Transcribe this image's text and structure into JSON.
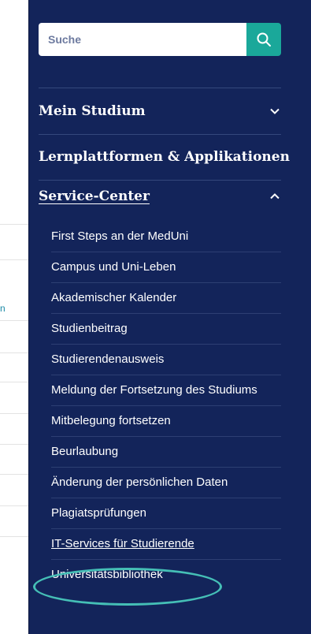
{
  "background": {
    "partial_link_text": "n"
  },
  "search": {
    "placeholder": "Suche"
  },
  "menu": {
    "sections": [
      {
        "label": "Mein Studium",
        "expanded": false
      },
      {
        "label": "Lernplattformen & Applikationen"
      },
      {
        "label": "Service-Center",
        "expanded": true
      }
    ],
    "service_center_items": [
      "First Steps an der MedUni",
      "Campus und Uni-Leben",
      "Akademischer Kalender",
      "Studienbeitrag",
      "Studierendenausweis",
      "Meldung der Fortsetzung des Studiums",
      "Mitbelegung fortsetzen",
      "Beurlaubung",
      "Änderung der persönlichen Daten",
      "Plagiatsprüfungen",
      "IT-Services für Studierende",
      "Universitätsbibliothek"
    ],
    "highlighted_item": "IT-Services für Studierende"
  },
  "colors": {
    "panel": "#13245a",
    "accent": "#1aa89a",
    "highlight_ring": "#45bfb6"
  }
}
